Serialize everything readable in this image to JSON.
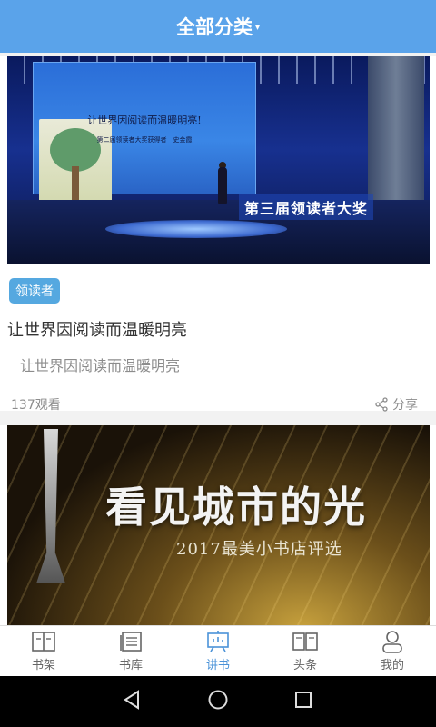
{
  "header": {
    "title": "全部分类",
    "caret": "▾"
  },
  "cards": [
    {
      "image": {
        "screen_line1": "让世界因阅读而温暖明亮!",
        "screen_line2": "第二届领读者大奖获得者　史金霞",
        "banner": "第三届领读者大奖"
      },
      "tag": "领读者",
      "title": "让世界因阅读而温暖明亮",
      "subtitle": "让世界因阅读而温暖明亮",
      "views": "137观看",
      "share_label": "分享"
    },
    {
      "image": {
        "headline": "看见城市的光",
        "subline": "2017最美小书店评选"
      }
    }
  ],
  "bottom_nav": [
    {
      "label": "书架",
      "icon": "bookshelf-icon",
      "active": false
    },
    {
      "label": "书库",
      "icon": "library-icon",
      "active": false
    },
    {
      "label": "讲书",
      "icon": "lecture-icon",
      "active": true
    },
    {
      "label": "头条",
      "icon": "headlines-icon",
      "active": false
    },
    {
      "label": "我的",
      "icon": "profile-icon",
      "active": false
    }
  ],
  "colors": {
    "header": "#5aa3ea",
    "active": "#4b93d8",
    "tag": "#55a8e0"
  }
}
